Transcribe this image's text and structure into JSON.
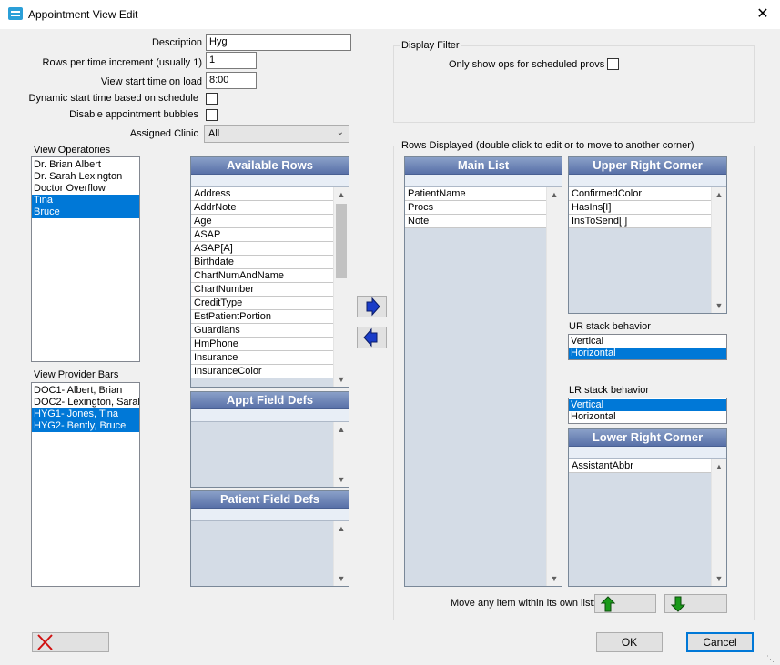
{
  "window": {
    "title": "Appointment View Edit",
    "close_glyph": "✕"
  },
  "form": {
    "description_label": "Description",
    "description_value": "Hyg",
    "rows_per_label": "Rows per time increment (usually 1)",
    "rows_per_value": "1",
    "view_start_label": "View start time on load",
    "view_start_value": "8:00",
    "dynamic_start_label": "Dynamic start time based on schedule",
    "disable_bubbles_label": "Disable appointment bubbles",
    "assigned_clinic_label": "Assigned Clinic",
    "assigned_clinic_value": "All"
  },
  "display_filter": {
    "title": "Display Filter",
    "only_show_label": "Only show ops for scheduled provs"
  },
  "operatories": {
    "label": "View Operatories",
    "items": [
      "Dr. Brian Albert",
      "Dr. Sarah Lexington",
      "Doctor Overflow",
      "Tina",
      "Bruce"
    ]
  },
  "provider_bars": {
    "label": "View Provider Bars",
    "items": [
      "DOC1- Albert, Brian",
      "DOC2- Lexington, Sarah",
      "HYG1- Jones, Tina",
      "HYG2- Bently, Bruce"
    ]
  },
  "available_rows": {
    "title": "Available Rows",
    "items": [
      "Address",
      "AddrNote",
      "Age",
      "ASAP",
      "ASAP[A]",
      "Birthdate",
      "ChartNumAndName",
      "ChartNumber",
      "CreditType",
      "EstPatientPortion",
      "Guardians",
      "HmPhone",
      "Insurance",
      "InsuranceColor"
    ]
  },
  "appt_field_defs": {
    "title": "Appt Field Defs"
  },
  "patient_field_defs": {
    "title": "Patient Field Defs"
  },
  "rows_displayed": {
    "title": "Rows Displayed (double click to edit or to move to another corner)"
  },
  "main_list": {
    "title": "Main List",
    "items": [
      "PatientName",
      "Procs",
      "Note"
    ]
  },
  "upper_right": {
    "title": "Upper Right Corner",
    "items": [
      "ConfirmedColor",
      "HasIns[I]",
      "InsToSend[!]"
    ]
  },
  "ur_stack": {
    "label": "UR stack behavior",
    "options": [
      "Vertical",
      "Horizontal"
    ],
    "selected": "Horizontal"
  },
  "lr_stack": {
    "label": "LR stack behavior",
    "options": [
      "Vertical",
      "Horizontal"
    ],
    "selected": "Vertical"
  },
  "lower_right": {
    "title": "Lower Right Corner",
    "items": [
      "AssistantAbbr"
    ]
  },
  "move_label": "Move any item within its own list:",
  "buttons": {
    "ok": "OK",
    "cancel": "Cancel"
  },
  "colors": {
    "selection": "#0078d7",
    "grid_title": "#5870a8",
    "arrow_blue": "#1a3cc8",
    "arrow_green": "#1a9a1a",
    "delete_red": "#d01010"
  }
}
